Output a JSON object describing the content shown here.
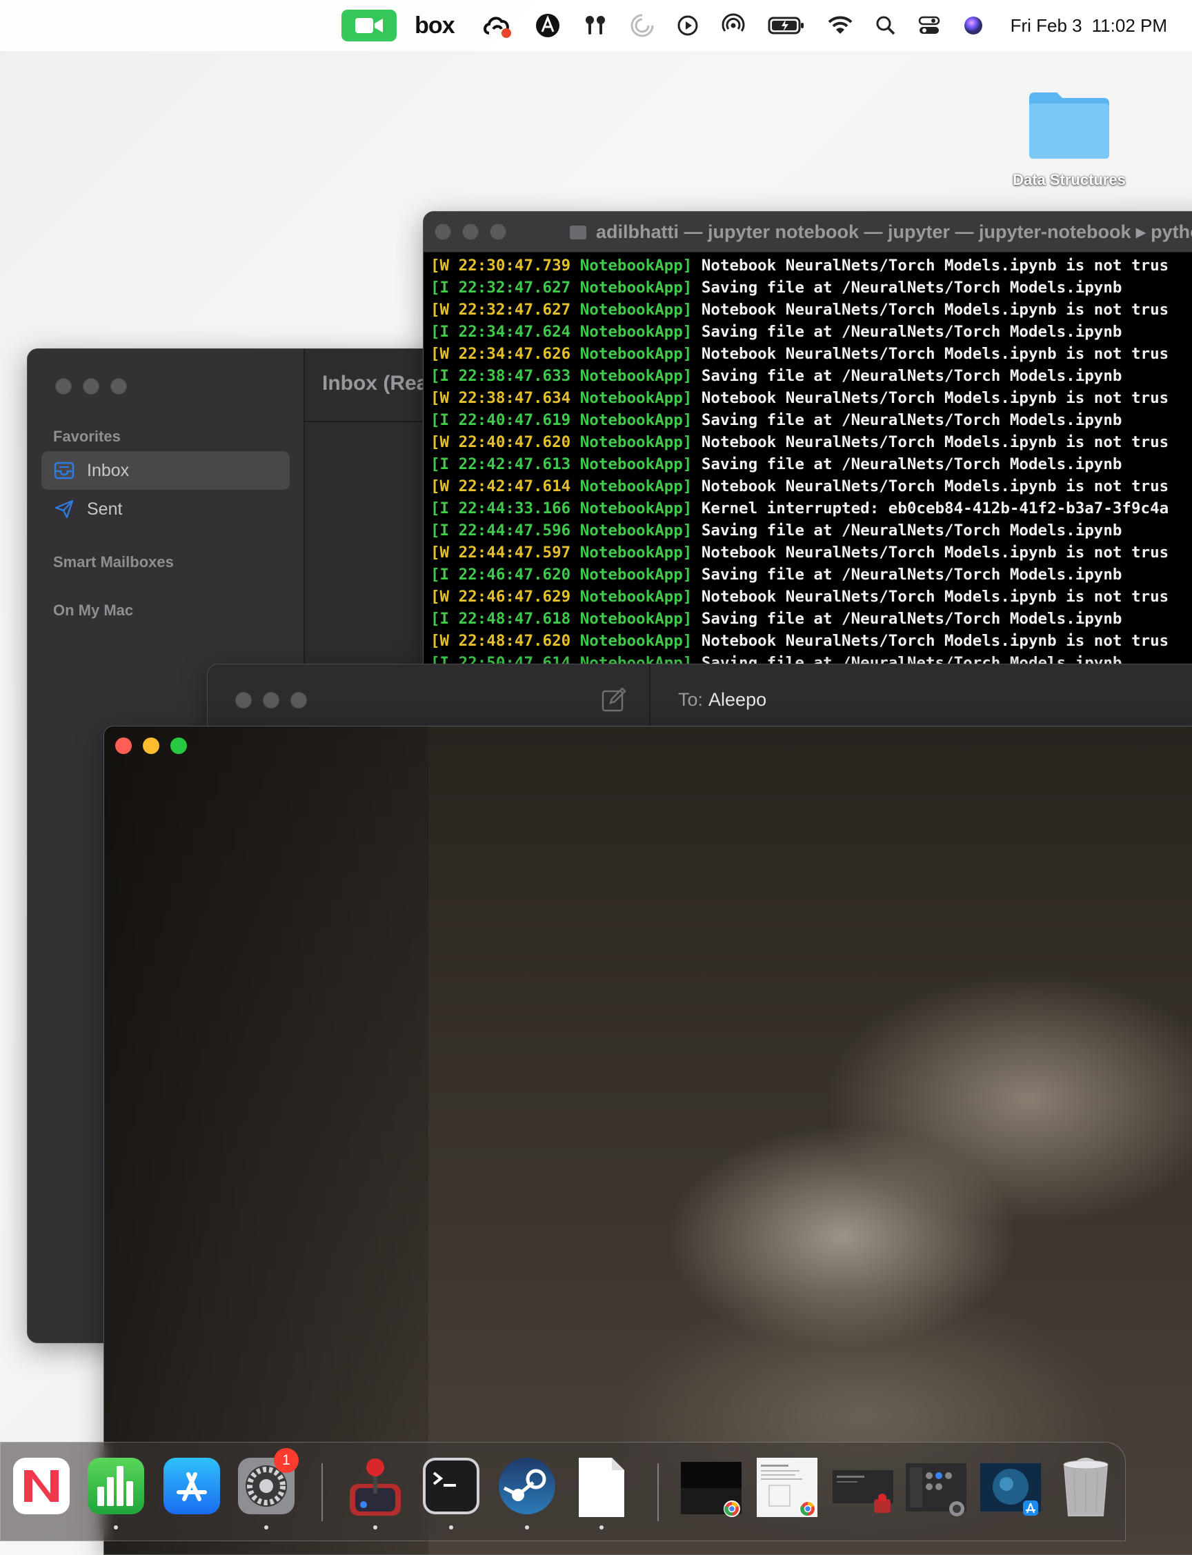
{
  "menubar": {
    "icons": [
      "facetime-icon",
      "box-icon",
      "creative-cloud-icon",
      "astro-icon",
      "airpods-icon",
      "spinner-icon",
      "play-icon",
      "airdrop-icon",
      "battery-icon",
      "wifi-icon",
      "spotlight-icon",
      "control-center-icon",
      "siri-icon"
    ],
    "box_label": "box",
    "clock_date": "Fri Feb 3",
    "clock_time": "11:02 PM"
  },
  "desktop": {
    "folder_label": "Data Structures",
    "folder_color": "#5bb5f0"
  },
  "terminal": {
    "title": "adilbhatti — jupyter notebook — jupyter — jupyter-notebook ▸ pytho",
    "lines": [
      {
        "level": "[W",
        "time": "22:30:47.739",
        "app": "NotebookApp]",
        "msg": "Notebook NeuralNets/Torch Models.ipynb is not trus"
      },
      {
        "level": "[I",
        "time": "22:32:47.627",
        "app": "NotebookApp]",
        "msg": "Saving file at /NeuralNets/Torch Models.ipynb"
      },
      {
        "level": "[W",
        "time": "22:32:47.627",
        "app": "NotebookApp]",
        "msg": "Notebook NeuralNets/Torch Models.ipynb is not trus"
      },
      {
        "level": "[I",
        "time": "22:34:47.624",
        "app": "NotebookApp]",
        "msg": "Saving file at /NeuralNets/Torch Models.ipynb"
      },
      {
        "level": "[W",
        "time": "22:34:47.626",
        "app": "NotebookApp]",
        "msg": "Notebook NeuralNets/Torch Models.ipynb is not trus"
      },
      {
        "level": "[I",
        "time": "22:38:47.633",
        "app": "NotebookApp]",
        "msg": "Saving file at /NeuralNets/Torch Models.ipynb"
      },
      {
        "level": "[W",
        "time": "22:38:47.634",
        "app": "NotebookApp]",
        "msg": "Notebook NeuralNets/Torch Models.ipynb is not trus"
      },
      {
        "level": "[I",
        "time": "22:40:47.619",
        "app": "NotebookApp]",
        "msg": "Saving file at /NeuralNets/Torch Models.ipynb"
      },
      {
        "level": "[W",
        "time": "22:40:47.620",
        "app": "NotebookApp]",
        "msg": "Notebook NeuralNets/Torch Models.ipynb is not trus"
      },
      {
        "level": "[I",
        "time": "22:42:47.613",
        "app": "NotebookApp]",
        "msg": "Saving file at /NeuralNets/Torch Models.ipynb"
      },
      {
        "level": "[W",
        "time": "22:42:47.614",
        "app": "NotebookApp]",
        "msg": "Notebook NeuralNets/Torch Models.ipynb is not trus"
      },
      {
        "level": "[I",
        "time": "22:44:33.166",
        "app": "NotebookApp]",
        "msg": "Kernel interrupted: eb0ceb84-412b-41f2-b3a7-3f9c4a"
      },
      {
        "level": "[I",
        "time": "22:44:47.596",
        "app": "NotebookApp]",
        "msg": "Saving file at /NeuralNets/Torch Models.ipynb"
      },
      {
        "level": "[W",
        "time": "22:44:47.597",
        "app": "NotebookApp]",
        "msg": "Notebook NeuralNets/Torch Models.ipynb is not trus"
      },
      {
        "level": "[I",
        "time": "22:46:47.620",
        "app": "NotebookApp]",
        "msg": "Saving file at /NeuralNets/Torch Models.ipynb"
      },
      {
        "level": "[W",
        "time": "22:46:47.629",
        "app": "NotebookApp]",
        "msg": "Notebook NeuralNets/Torch Models.ipynb is not trus"
      },
      {
        "level": "[I",
        "time": "22:48:47.618",
        "app": "NotebookApp]",
        "msg": "Saving file at /NeuralNets/Torch Models.ipynb"
      },
      {
        "level": "[W",
        "time": "22:48:47.620",
        "app": "NotebookApp]",
        "msg": "Notebook NeuralNets/Torch Models.ipynb is not trus"
      },
      {
        "level": "[I",
        "time": "22:50:47.614",
        "app": "NotebookApp]",
        "msg": "Saving file at /NeuralNets/Torch Models.ipynb"
      }
    ]
  },
  "mail": {
    "list_title": "Inbox (Rea",
    "sidebar": {
      "favorites_header": "Favorites",
      "items": [
        {
          "label": "Inbox",
          "icon": "inbox-tray-icon"
        },
        {
          "label": "Sent",
          "icon": "paper-plane-icon"
        }
      ],
      "smart_mailboxes_header": "Smart Mailboxes",
      "on_my_mac_header": "On My Mac"
    }
  },
  "compose": {
    "to_label": "To:",
    "to_value": "Aleepo"
  },
  "dock": {
    "items": [
      {
        "name": "news-icon",
        "running": false
      },
      {
        "name": "numbers-icon",
        "running": true
      },
      {
        "name": "app-store-icon",
        "running": false
      },
      {
        "name": "system-settings-icon",
        "running": true,
        "badge": "1"
      },
      {
        "name": "joystick-icon",
        "running": true
      },
      {
        "name": "terminal-icon",
        "running": true
      },
      {
        "name": "steam-icon",
        "running": true
      },
      {
        "name": "blank-document-icon",
        "running": true
      },
      {
        "name": "chrome-window-thumb-1",
        "running": false
      },
      {
        "name": "chrome-window-thumb-2",
        "running": false
      },
      {
        "name": "joystick-window-thumb",
        "running": false
      },
      {
        "name": "settings-window-thumb",
        "running": false
      },
      {
        "name": "appstore-window-thumb",
        "running": false
      },
      {
        "name": "trash-icon",
        "running": false
      }
    ]
  }
}
